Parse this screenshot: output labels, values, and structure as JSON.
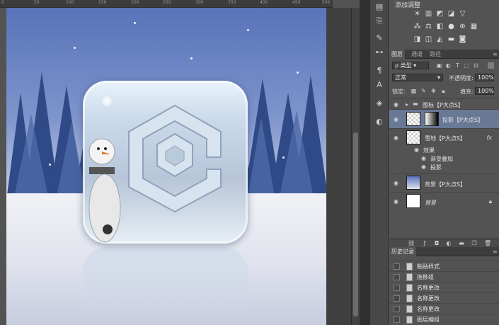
{
  "adjustments": {
    "title": "添加调整",
    "icons": [
      "brightness-icon",
      "levels-icon",
      "curves-icon",
      "exposure-icon",
      "vibrance-icon",
      "hue-saturation-icon",
      "color-balance-icon",
      "black-white-icon",
      "photo-filter-icon",
      "channel-mixer-icon",
      "color-lookup-icon",
      "invert-icon",
      "posterize-icon",
      "threshold-icon",
      "gradient-map-icon",
      "selective-color-icon"
    ]
  },
  "layers_panel": {
    "tabs": [
      "图层",
      "通道",
      "路径"
    ],
    "filter_kind": "类型",
    "blend_mode": "正常",
    "opacity_label": "不透明度:",
    "opacity_value": "100%",
    "lock_label": "锁定:",
    "fill_label": "填充:",
    "fill_value": "100%",
    "layers": [
      {
        "name": "图标【P大点S】",
        "type": "group"
      },
      {
        "name": "投影【P大点S】",
        "type": "layer",
        "selected": true
      },
      {
        "name": "雪地【P大点S】",
        "type": "layer",
        "fx": "fx"
      },
      {
        "name": "效果",
        "type": "effect-header"
      },
      {
        "name": "渐变叠加",
        "type": "effect"
      },
      {
        "name": "投影",
        "type": "effect"
      },
      {
        "name": "背景【P大点S】",
        "type": "layer"
      },
      {
        "name": "背景",
        "type": "background"
      }
    ]
  },
  "history_panel": {
    "tab": "历史记录",
    "items": [
      "粘贴样式",
      "拖移组",
      "名称更改",
      "名称更改",
      "名称更改",
      "图层编组"
    ]
  },
  "ruler": {
    "marks": [
      "0",
      "50",
      "100",
      "150",
      "200",
      "250",
      "300",
      "350",
      "400",
      "450",
      "500"
    ]
  },
  "colors": {
    "panel_bg": "#535353",
    "selected_layer": "#687895",
    "sky_top": "#5873b8",
    "snow": "#e9ebf2"
  }
}
